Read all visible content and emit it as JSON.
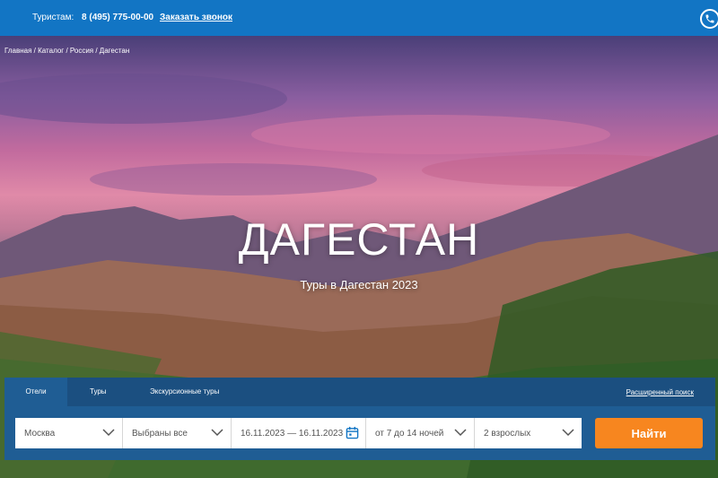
{
  "topbar": {
    "tourists_label": "Туристам:",
    "phone": "8 (495) 775-00-00",
    "callback": "Заказать звонок"
  },
  "breadcrumb": {
    "items": [
      "Главная",
      "Каталог",
      "Россия",
      "Дагестан"
    ],
    "separator": " / "
  },
  "hero": {
    "title": "ДАГЕСТАН",
    "subtitle": "Туры в Дагестан 2023"
  },
  "search": {
    "tabs": [
      {
        "label": "Отели",
        "active": true
      },
      {
        "label": "Туры",
        "active": false
      },
      {
        "label": "Экскурсионные туры",
        "active": false
      }
    ],
    "advanced": "Расширенный поиск",
    "fields": {
      "departure": "Москва",
      "destination": "Выбраны все",
      "dates": "16.11.2023 — 16.11.2023",
      "nights": "от 7 до 14 ночей",
      "guests": "2 взрослых"
    },
    "submit": "Найти"
  },
  "colors": {
    "topbar": "#1275c4",
    "panel": "#1f5d94",
    "tabs_bg": "#1b4f80",
    "accent_button": "#f7861f"
  },
  "icons": {
    "phone": "phone-icon",
    "chevron": "chevron-down-icon",
    "calendar": "calendar-icon"
  }
}
